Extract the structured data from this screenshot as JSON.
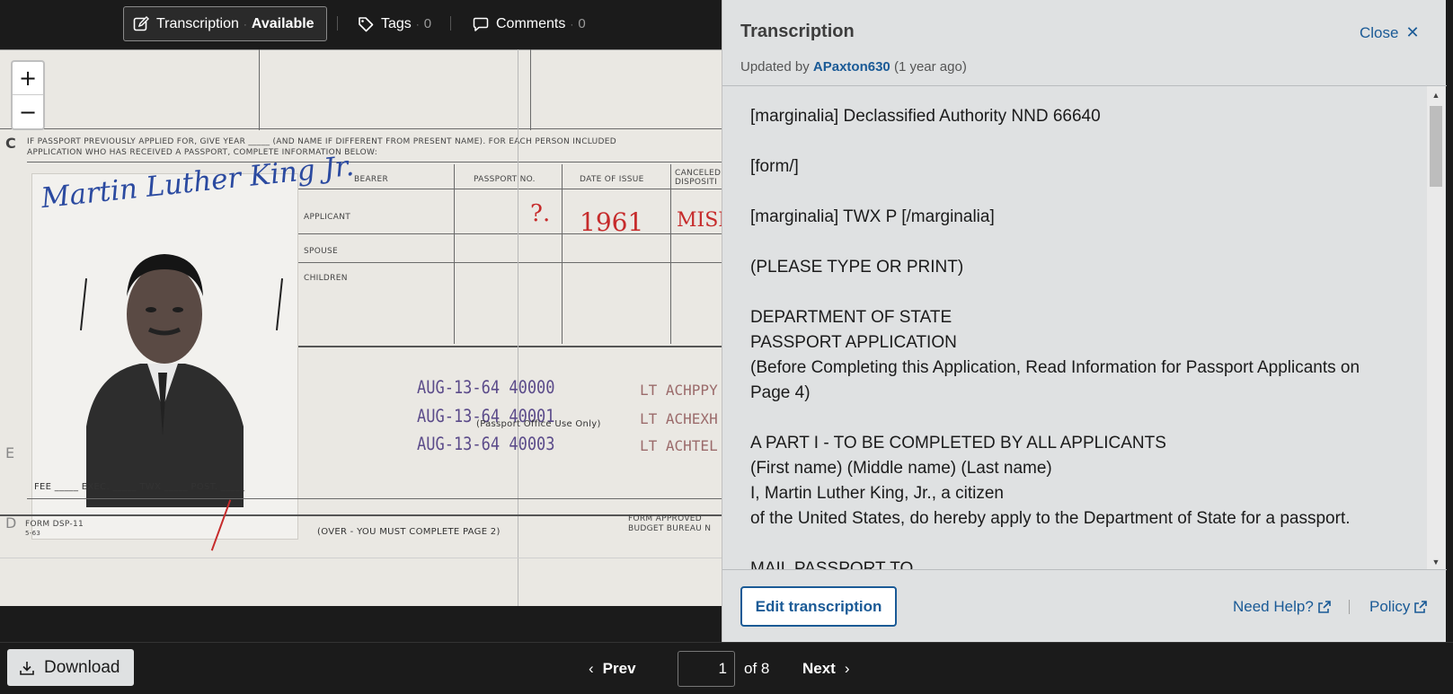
{
  "toolbar": {
    "transcription_label": "Transcription",
    "transcription_status": "Available",
    "tags_label": "Tags",
    "tags_count": "0",
    "comments_label": "Comments",
    "comments_count": "0"
  },
  "viewer": {
    "zoom_in": "+",
    "zoom_out": "−",
    "document": {
      "passport_question": "IF PASSPORT PREVIOUSLY APPLIED FOR, GIVE YEAR _____ (AND NAME IF DIFFERENT FROM PRESENT NAME). FOR EACH PERSON INCLUDED",
      "passport_question_2": "APPLICATION WHO HAS RECEIVED A PASSPORT, COMPLETE INFORMATION BELOW:",
      "col_bearer": "BEARER",
      "col_passport_no": "PASSPORT NO.",
      "col_date_of_issue": "DATE OF ISSUE",
      "col_cancelled": "CANCELED DISPOSITI",
      "row_applicant": "APPLICANT",
      "row_spouse": "SPOUSE",
      "row_children": "CHILDREN",
      "signature": "Martin Luther King Jr.",
      "red_mark_1": "?.",
      "red_mark_2": "1961",
      "red_mark_3": "MISP",
      "stamp_1": "AUG-13-64  40000",
      "stamp_2": "AUG-13-64  40001",
      "stamp_3": "AUG-13-64  40003",
      "stamp_lt_1": "LT ACHPPY",
      "stamp_lt_2": "LT ACHEXH",
      "stamp_lt_3": "LT ACHTEL",
      "passport_office": "(Passport Office Use Only)",
      "fee_row": "FEE _____ EXEC. _____ TWX _____ POST. _____",
      "form_no": "FORM DSP-11",
      "form_date": "5-63",
      "over_note": "(OVER - YOU MUST COMPLETE PAGE 2)",
      "form_approved": "FORM APPROVED",
      "budget_bureau": "BUDGET BUREAU N",
      "margin_c": "C",
      "margin_d": "D",
      "margin_e": "E"
    }
  },
  "panel": {
    "title": "Transcription",
    "close_label": "Close",
    "updated_prefix": "Updated by",
    "updated_user": "APaxton630",
    "updated_when": "(1 year ago)",
    "lines": [
      "[marginalia] Declassified Authority NND 66640",
      "",
      "[form/]",
      "",
      "[marginalia] TWX P [/marginalia]",
      "",
      "(PLEASE TYPE OR PRINT)",
      "",
      "DEPARTMENT OF STATE",
      "PASSPORT APPLICATION",
      "(Before Completing this Application, Read Information for Passport Applicants on Page 4)",
      "",
      "A PART I - TO BE COMPLETED BY ALL APPLICANTS",
      "(First name) (Middle name) (Last name)",
      "I, Martin Luther King, Jr., a citizen",
      "of the United States, do hereby apply to the Department of State for a passport.",
      "",
      "MAIL PASSPORT TO"
    ],
    "edit_button": "Edit transcription",
    "need_help": "Need Help?",
    "policy": "Policy"
  },
  "bottombar": {
    "download_label": "Download",
    "prev_label": "Prev",
    "page_value": "1",
    "of_label": "of 8",
    "next_label": "Next"
  },
  "colors": {
    "toolbar_bg": "#1b1b1b",
    "panel_bg": "#dfe1e2",
    "link_blue": "#1a5a96",
    "stamp_purple": "#5b4b8a",
    "ink_red": "#c62b2b",
    "signature_blue": "#2b4aa0"
  },
  "icons": {
    "transcription": "edit-square-icon",
    "tags": "tag-icon",
    "comments": "speech-bubble-icon",
    "close": "close-x-icon",
    "external": "external-link-icon",
    "download": "download-icon",
    "prev": "chevron-left-icon",
    "next": "chevron-right-icon"
  }
}
